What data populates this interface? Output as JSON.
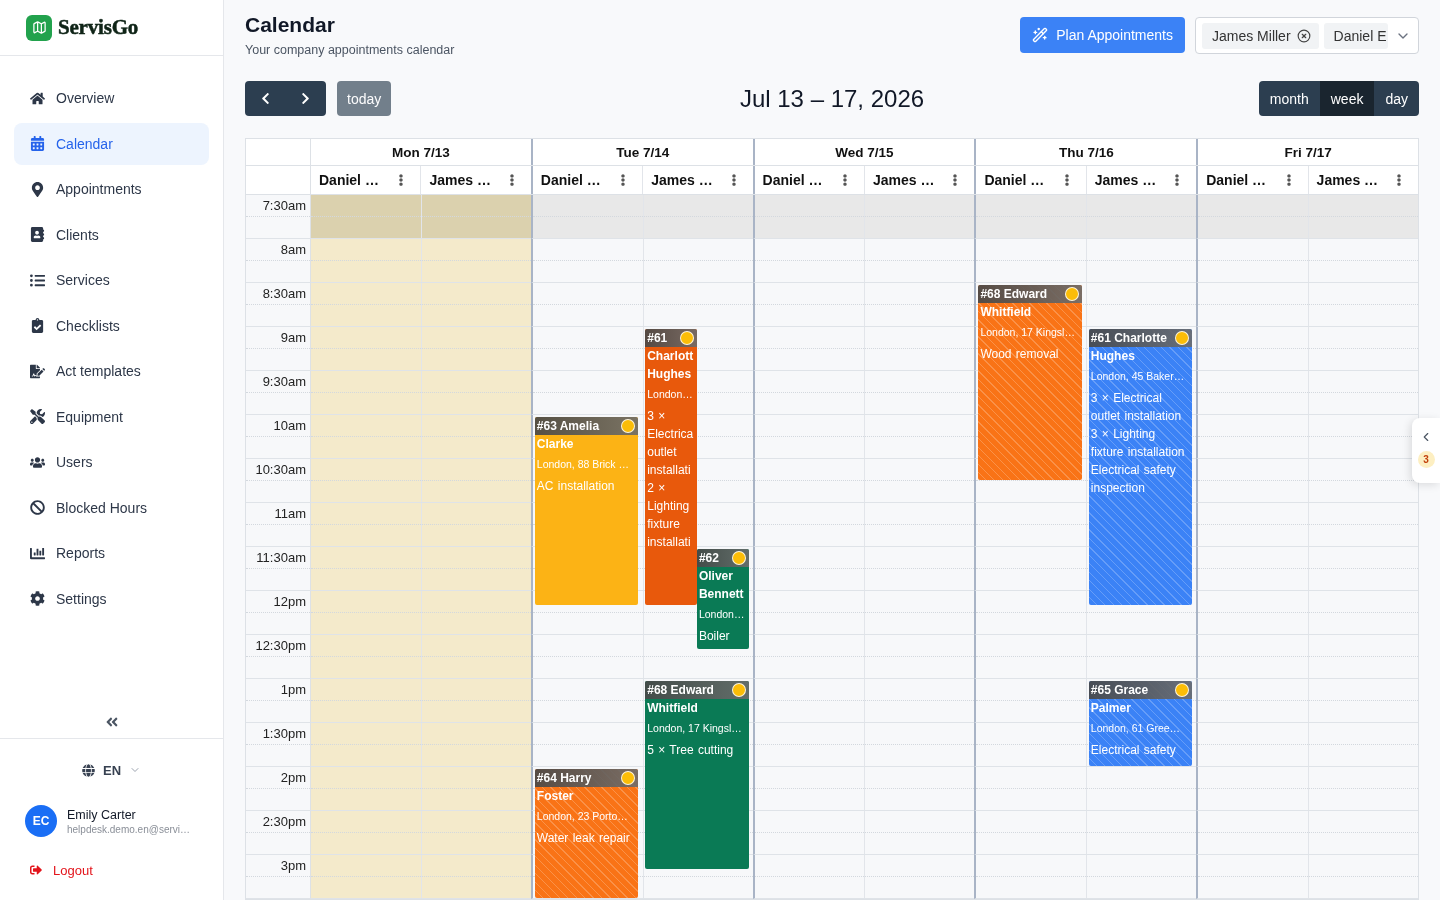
{
  "brand": {
    "name": "ServisGo"
  },
  "sidebar": {
    "items": [
      {
        "label": "Overview",
        "selected": false
      },
      {
        "label": "Calendar",
        "selected": true
      },
      {
        "label": "Appointments",
        "selected": false
      },
      {
        "label": "Clients",
        "selected": false
      },
      {
        "label": "Services",
        "selected": false
      },
      {
        "label": "Checklists",
        "selected": false
      },
      {
        "label": "Act templates",
        "selected": false
      },
      {
        "label": "Equipment",
        "selected": false
      },
      {
        "label": "Users",
        "selected": false
      },
      {
        "label": "Blocked Hours",
        "selected": false
      },
      {
        "label": "Reports",
        "selected": false
      },
      {
        "label": "Settings",
        "selected": false
      }
    ],
    "language": "EN",
    "user": {
      "initials": "EC",
      "name": "Emily Carter",
      "email": "helpdesk.demo.en@servi…"
    },
    "logout": "Logout"
  },
  "header": {
    "title": "Calendar",
    "subtitle": "Your company appointments calendar",
    "plan_button": "Plan Appointments",
    "staff_filter": {
      "chips": [
        {
          "label": "James Miller",
          "removable": true
        },
        {
          "label": "Daniel E",
          "removable": false
        }
      ]
    }
  },
  "toolbar": {
    "today": {
      "label": "today",
      "disabled": true
    },
    "range": "Jul 13 – 17, 2026",
    "views": [
      {
        "label": "month",
        "selected": false
      },
      {
        "label": "week",
        "selected": true
      },
      {
        "label": "day",
        "selected": false
      }
    ]
  },
  "calendar": {
    "times": [
      {
        "label": "7:30am",
        "closed": true
      },
      {
        "label": "8am",
        "closed": false
      },
      {
        "label": "8:30am",
        "closed": false
      },
      {
        "label": "9am",
        "closed": false
      },
      {
        "label": "9:30am",
        "closed": false
      },
      {
        "label": "10am",
        "closed": false
      },
      {
        "label": "10:30am",
        "closed": false
      },
      {
        "label": "11am",
        "closed": false
      },
      {
        "label": "11:30am",
        "closed": false
      },
      {
        "label": "12pm",
        "closed": false
      },
      {
        "label": "12:30pm",
        "closed": false
      },
      {
        "label": "1pm",
        "closed": false
      },
      {
        "label": "1:30pm",
        "closed": false
      },
      {
        "label": "2pm",
        "closed": false
      },
      {
        "label": "2:30pm",
        "closed": false
      },
      {
        "label": "3pm",
        "closed": false
      }
    ],
    "days": [
      {
        "label": "Mon 7/13",
        "today": true,
        "resources": [
          {
            "name": "Daniel …"
          },
          {
            "name": "James …"
          }
        ]
      },
      {
        "label": "Tue 7/14",
        "today": false,
        "resources": [
          {
            "name": "Daniel …",
            "events": [
              {
                "title": "#63 Amelia Clarke",
                "address": "London, 88 Brick …",
                "services": [
                  "AC installation"
                ],
                "color": "#fcb315",
                "striped": false
              },
              {
                "title": "#64 Harry Foster",
                "address": "London, 23 Porto…",
                "services": [
                  "Water leak repair"
                ],
                "color": "#f97316",
                "striped": true
              }
            ]
          },
          {
            "name": "James …",
            "events": [
              {
                "title": "#61 Charlott Hughes",
                "address": "London…",
                "services": [
                  "3 × Electrica outlet installati",
                  "2 × Lighting fixture installati"
                ],
                "color": "#e8590c",
                "striped": false
              },
              {
                "title": "#62 Oliver Bennett",
                "address": "London…",
                "services": [
                  "Boiler"
                ],
                "color": "#0a7a55",
                "striped": false
              },
              {
                "title": "#68 Edward Whitfield",
                "address": "London, 17 Kingsl…",
                "services": [
                  "5 × Tree cutting"
                ],
                "color": "#0a7a55",
                "striped": false
              }
            ]
          }
        ]
      },
      {
        "label": "Wed 7/15",
        "today": false,
        "resources": [
          {
            "name": "Daniel …"
          },
          {
            "name": "James …"
          }
        ]
      },
      {
        "label": "Thu 7/16",
        "today": false,
        "resources": [
          {
            "name": "Daniel …",
            "events": [
              {
                "title": "#68 Edward Whitfield",
                "address": "London, 17 Kingsl…",
                "services": [
                  "Wood removal"
                ],
                "color": "#f97316",
                "striped": true
              }
            ]
          },
          {
            "name": "James …",
            "events": [
              {
                "title": "#61 Charlotte Hughes",
                "address": "London, 45 Baker…",
                "services": [
                  "3 × Electrical outlet installation",
                  "3 × Lighting fixture installation",
                  "Electrical safety inspection"
                ],
                "color": "#3b82f6",
                "striped": true
              },
              {
                "title": "#65 Grace Palmer",
                "address": "London, 61 Gree…",
                "services": [
                  "Electrical safety"
                ],
                "color": "#3b82f6",
                "striped": true
              }
            ]
          }
        ]
      },
      {
        "label": "Fri 7/17",
        "today": false,
        "resources": [
          {
            "name": "Daniel …"
          },
          {
            "name": "James …"
          }
        ]
      }
    ]
  },
  "side_panel": {
    "badge": "3"
  }
}
